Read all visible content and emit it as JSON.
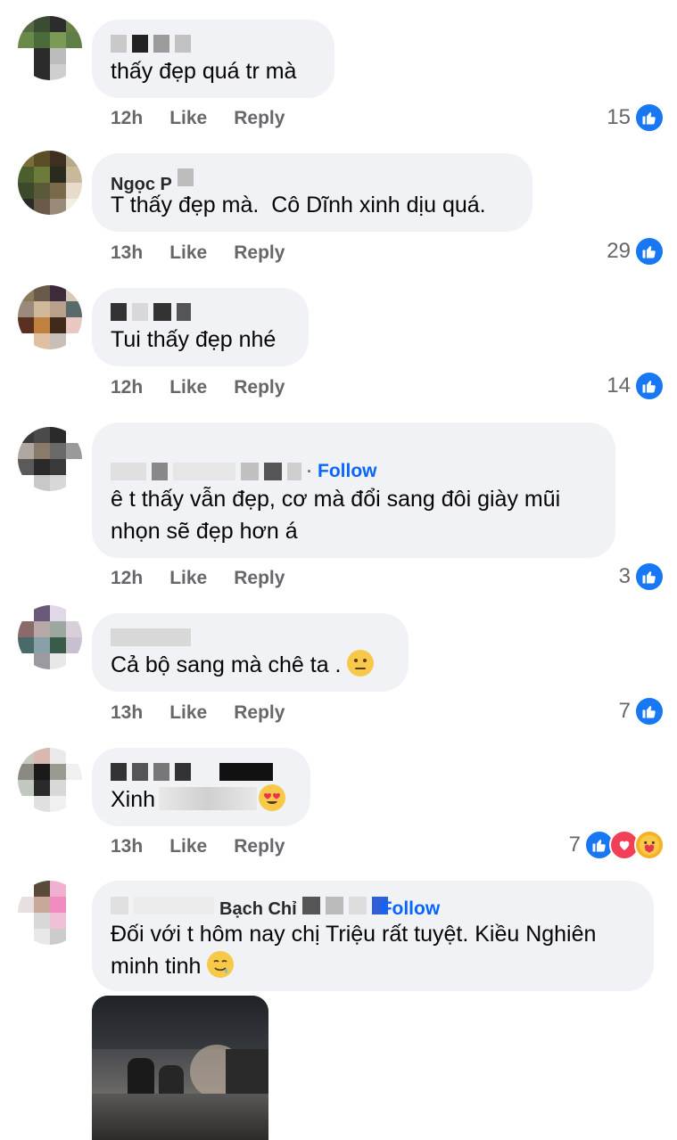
{
  "comments": [
    {
      "name": "",
      "text": "thấy đẹp quá tr mà",
      "time": "12h",
      "like": "Like",
      "reply": "Reply",
      "reactions": "15",
      "follow": ""
    },
    {
      "name": "Ngọc P",
      "text": "T thấy đẹp mà.  Cô Dĩnh xinh dịu quá.",
      "time": "13h",
      "like": "Like",
      "reply": "Reply",
      "reactions": "29",
      "follow": ""
    },
    {
      "name": "",
      "text": "Tui thấy đẹp nhé",
      "time": "12h",
      "like": "Like",
      "reply": "Reply",
      "reactions": "14",
      "follow": ""
    },
    {
      "name": "",
      "text": "ê t thấy vẫn đẹp, cơ mà đổi sang đôi giày mũi nhọn sẽ đẹp hơn á",
      "time": "12h",
      "like": "Like",
      "reply": "Reply",
      "reactions": "3",
      "follow": "Follow"
    },
    {
      "name": "",
      "text": "Cả bộ sang mà chê ta .",
      "time": "13h",
      "like": "Like",
      "reply": "Reply",
      "reactions": "7",
      "follow": ""
    },
    {
      "name": "",
      "text": "Xinh",
      "time": "13h",
      "like": "Like",
      "reply": "Reply",
      "reactions": "7",
      "follow": ""
    },
    {
      "name": "Bạch Chỉ",
      "text": "Đối với t hôm nay chị Triệu rất tuyệt. Kiều Nghiên minh tinh",
      "time": "",
      "like": "",
      "reply": "",
      "reactions": "",
      "follow": "Follow"
    }
  ],
  "icons": {
    "like": "thumbs-up-icon",
    "heart": "heart-icon",
    "care": "care-icon"
  },
  "colors": {
    "accent": "#0866ff",
    "bubble": "#f0f2f5",
    "meta": "#65676b",
    "like": "#1877f2",
    "love": "#f33e58"
  }
}
